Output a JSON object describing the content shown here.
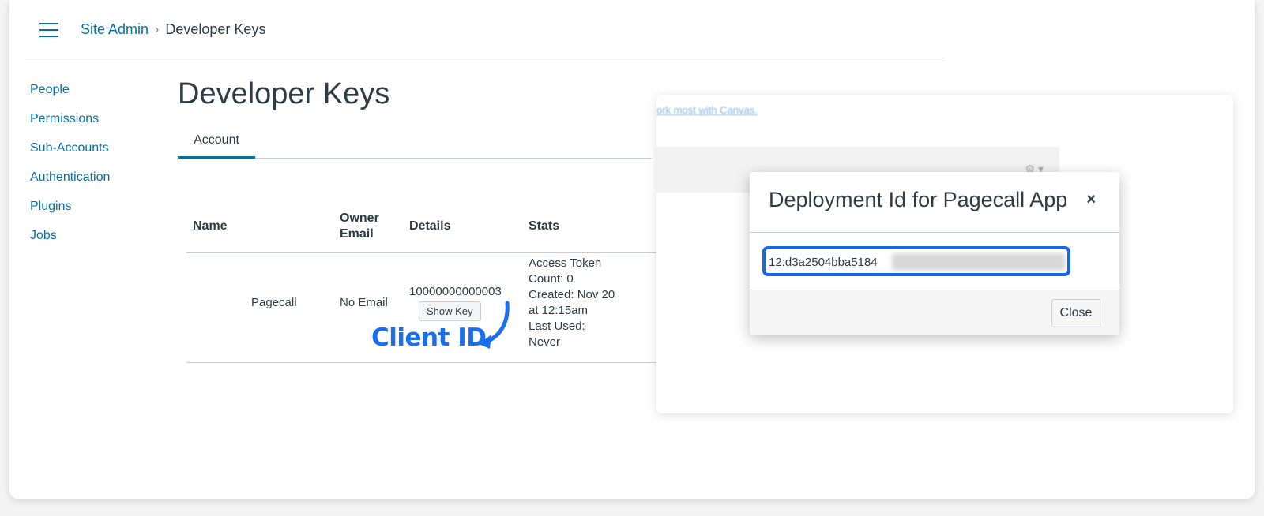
{
  "breadcrumb": {
    "root": "Site Admin",
    "current": "Developer Keys"
  },
  "sidebar": {
    "items": [
      {
        "label": "People"
      },
      {
        "label": "Permissions"
      },
      {
        "label": "Sub-Accounts"
      },
      {
        "label": "Authentication"
      },
      {
        "label": "Plugins"
      },
      {
        "label": "Jobs"
      }
    ]
  },
  "main": {
    "title": "Developer Keys",
    "tabs": [
      {
        "label": "Account"
      }
    ],
    "table": {
      "headers": {
        "name": "Name",
        "owner_email_line1": "Owner",
        "owner_email_line2": "Email",
        "details": "Details",
        "stats": "Stats"
      },
      "rows": [
        {
          "name": "Pagecall",
          "owner_email": "No Email",
          "details_id": "10000000000003",
          "show_key_label": "Show Key",
          "stats": [
            "Access Token",
            "Count: 0",
            "Created: Nov 20",
            "at 12:15am",
            "Last Used:",
            "Never"
          ]
        }
      ]
    }
  },
  "annotation": {
    "label": "Client ID",
    "color": "#1a6ff0"
  },
  "background_panel": {
    "link_text": "ork most with Canvas."
  },
  "modal": {
    "title": "Deployment Id for Pagecall App",
    "close_symbol": "×",
    "deployment_id_visible": "12:d3a2504bba5184",
    "close_button_label": "Close"
  },
  "colors": {
    "link": "#0770a3",
    "highlight": "#1a66e8",
    "text": "#2d3b45"
  }
}
